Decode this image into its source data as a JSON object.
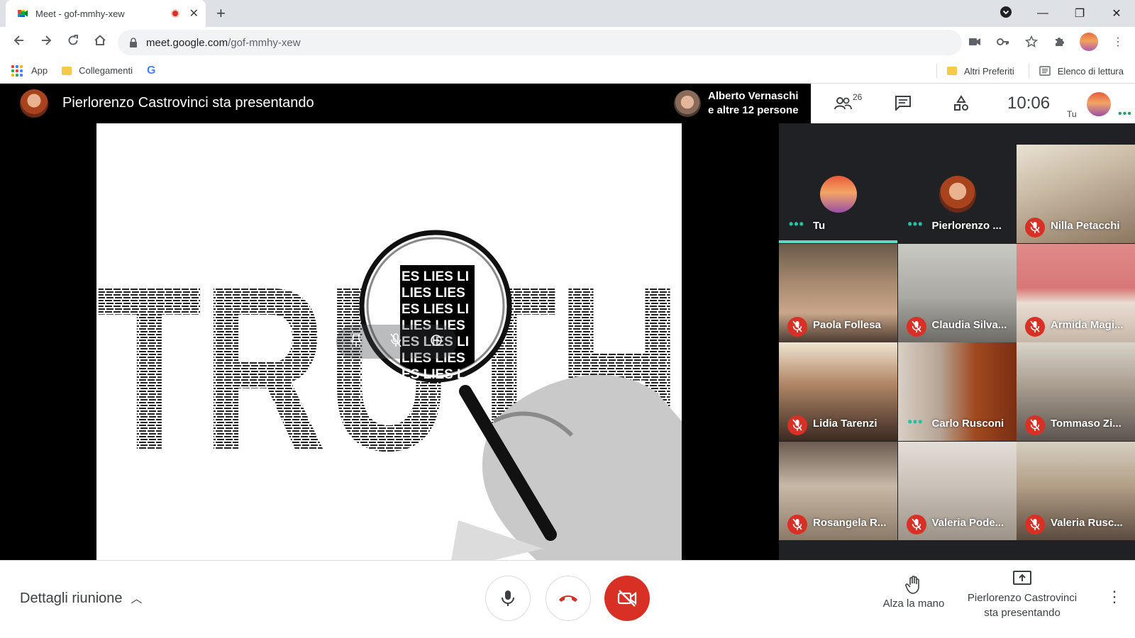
{
  "browser": {
    "tab_title": "Meet - gof-mmhy-xew",
    "tab_close": "✕",
    "new_tab": "+",
    "url_host": "meet.google.com",
    "url_path": "/gof-mmhy-xew",
    "window_controls": {
      "minimize": "—",
      "restore": "❐",
      "close": "✕"
    }
  },
  "bookmarks": {
    "apps_label": "App",
    "items": [
      {
        "label": "Collegamenti"
      },
      {
        "label": "G"
      }
    ],
    "others_label": "Altri Preferiti",
    "reading_list_label": "Elenco di lettura"
  },
  "meet": {
    "presenter_title": "Pierlorenzo Castrovinci sta presentando",
    "speaker_line1": "Alberto Vernaschi",
    "speaker_line2": "e altre 12 persone",
    "participant_count": "26",
    "clock": "10:06",
    "self_label": "Tu",
    "self_dots": "•••",
    "slide": {
      "word": "TRUTH",
      "lens_lines": [
        "ES LIES LI",
        "LIES LIES",
        "ES LIES LI",
        "LIES LIES",
        "ES LIES LI",
        "LIES LIES",
        "ES LIES L"
      ]
    },
    "tiles": [
      {
        "name": "Tu",
        "state": "dots",
        "kind": "avatar-self"
      },
      {
        "name": "Pierlorenzo ...",
        "state": "dots",
        "kind": "avatar-presenter"
      },
      {
        "name": "Nilla Petacchi",
        "state": "muted",
        "kind": "video"
      },
      {
        "name": "Paola Follesa",
        "state": "muted",
        "kind": "video"
      },
      {
        "name": "Claudia Silva...",
        "state": "muted",
        "kind": "video"
      },
      {
        "name": "Armida Magi...",
        "state": "muted",
        "kind": "video"
      },
      {
        "name": "Lidia Tarenzi",
        "state": "muted",
        "kind": "video"
      },
      {
        "name": "Carlo Rusconi",
        "state": "dots",
        "kind": "video"
      },
      {
        "name": "Tommaso Zi...",
        "state": "muted",
        "kind": "video"
      },
      {
        "name": "Rosangela R...",
        "state": "muted",
        "kind": "video"
      },
      {
        "name": "Valeria Pode...",
        "state": "muted",
        "kind": "video"
      },
      {
        "name": "Valeria Rusc...",
        "state": "muted",
        "kind": "video"
      }
    ],
    "bottom": {
      "details_label": "Dettagli riunione",
      "raise_hand_label": "Alza la mano",
      "present_line1": "Pierlorenzo Castrovinci",
      "present_line2": "sta presentando"
    }
  },
  "colors": {
    "accent_green": "#1ea362",
    "hangup_red": "#d93025",
    "active_teal": "#5fd9c4"
  }
}
